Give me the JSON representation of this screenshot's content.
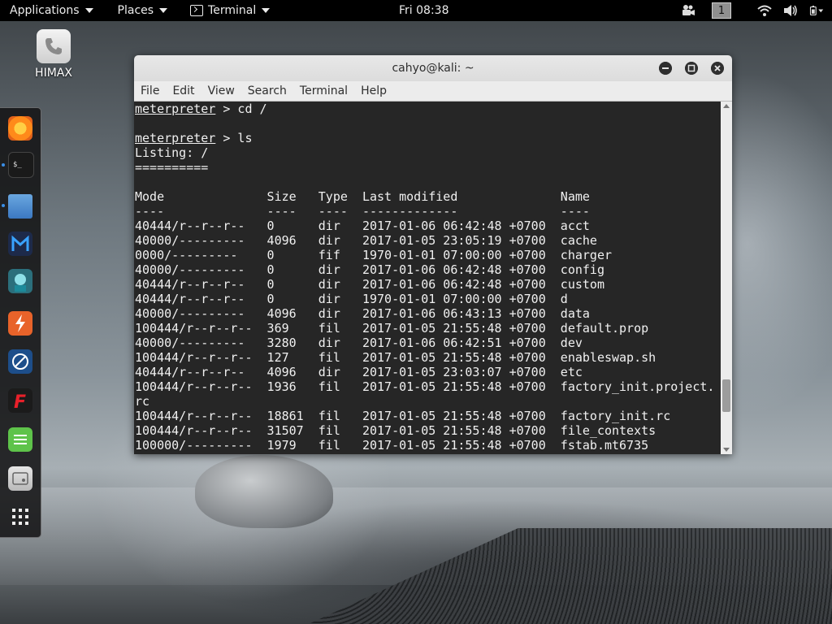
{
  "topbar": {
    "applications_label": "Applications",
    "places_label": "Places",
    "terminal_label": "Terminal",
    "clock": "Fri 08:38",
    "workspace_number": "1",
    "icons": [
      "video-camera-icon",
      "wifi-icon",
      "volume-icon",
      "battery-icon",
      "power-menu-caret-icon"
    ]
  },
  "desktop": {
    "icon_label": "HIMAX",
    "icon_name": "phone-icon"
  },
  "dock": {
    "items": [
      "firefox-icon",
      "terminal-icon",
      "files-icon",
      "metasploit-icon",
      "maltego-icon",
      "burpsuite-icon",
      "armitage-icon",
      "faraday-icon",
      "leafpad-icon",
      "cherrytree-icon",
      "show-apps-icon"
    ]
  },
  "window": {
    "title": "cahyo@kali: ~",
    "menu": [
      "File",
      "Edit",
      "View",
      "Search",
      "Terminal",
      "Help"
    ]
  },
  "terminal": {
    "prompt": "meterpreter",
    "lines": [
      {
        "prompt": "meterpreter",
        "cmd": " > cd /"
      },
      {
        "text": ""
      },
      {
        "prompt": "meterpreter",
        "cmd": " > ls"
      },
      {
        "text": "Listing: /"
      },
      {
        "text": "=========="
      },
      {
        "text": ""
      },
      {
        "text": "Mode              Size   Type  Last modified              Name"
      },
      {
        "text": "----              ----   ----  -------------              ----"
      },
      {
        "text": "40444/r--r--r--   0      dir   2017-01-06 06:42:48 +0700  acct"
      },
      {
        "text": "40000/---------   4096   dir   2017-01-05 23:05:19 +0700  cache"
      },
      {
        "text": "0000/---------    0      fif   1970-01-01 07:00:00 +0700  charger"
      },
      {
        "text": "40000/---------   0      dir   2017-01-06 06:42:48 +0700  config"
      },
      {
        "text": "40444/r--r--r--   0      dir   2017-01-06 06:42:48 +0700  custom"
      },
      {
        "text": "40444/r--r--r--   0      dir   1970-01-01 07:00:00 +0700  d"
      },
      {
        "text": "40000/---------   4096   dir   2017-01-06 06:43:13 +0700  data"
      },
      {
        "text": "100444/r--r--r--  369    fil   2017-01-05 21:55:48 +0700  default.prop"
      },
      {
        "text": "40000/---------   3280   dir   2017-01-06 06:42:51 +0700  dev"
      },
      {
        "text": "100444/r--r--r--  127    fil   2017-01-05 21:55:48 +0700  enableswap.sh"
      },
      {
        "text": "40444/r--r--r--   4096   dir   2017-01-05 23:03:07 +0700  etc"
      },
      {
        "text": "100444/r--r--r--  1936   fil   2017-01-05 21:55:48 +0700  factory_init.project."
      },
      {
        "text": "rc"
      },
      {
        "text": "100444/r--r--r--  18861  fil   2017-01-05 21:55:48 +0700  factory_init.rc"
      },
      {
        "text": "100444/r--r--r--  31507  fil   2017-01-05 21:55:48 +0700  file_contexts"
      },
      {
        "text": "100000/---------  1979   fil   2017-01-05 21:55:48 +0700  fstab.mt6735"
      }
    ]
  }
}
